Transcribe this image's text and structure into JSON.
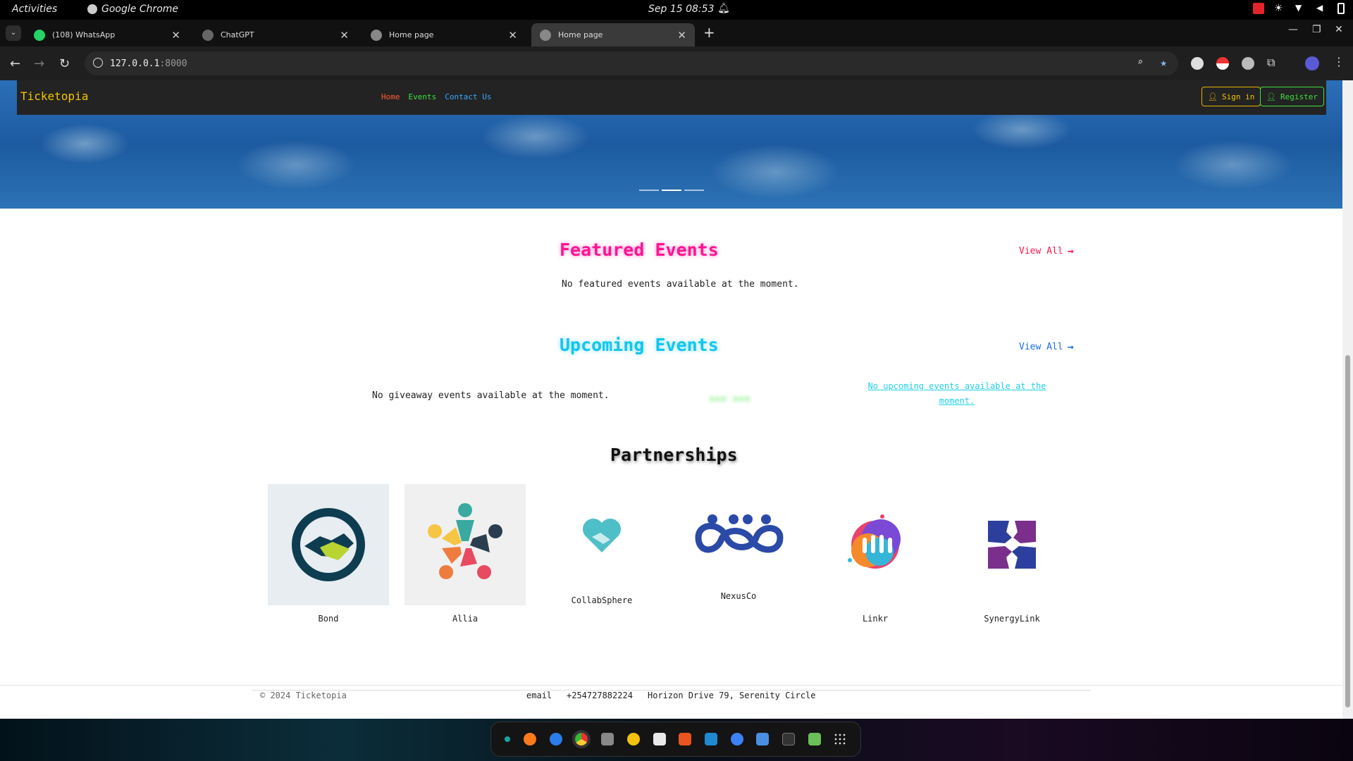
{
  "os": {
    "activities": "Activities",
    "app_name": "Google Chrome",
    "clock": "Sep 15 08:53"
  },
  "tabs": [
    {
      "label": "(108) WhatsApp",
      "active": false
    },
    {
      "label": "ChatGPT",
      "active": false
    },
    {
      "label": "Home page",
      "active": false
    },
    {
      "label": "Home page",
      "active": true
    }
  ],
  "address": {
    "host": "127.0.0.1",
    "port": ":8000"
  },
  "site": {
    "brand": "Ticketopia",
    "nav": {
      "home": "Home",
      "events": "Events",
      "contact": "Contact Us"
    },
    "signin": "Sign in",
    "register": "Register"
  },
  "featured": {
    "title": "Featured Events",
    "view_all": "View All",
    "empty": "No featured events available at the moment."
  },
  "upcoming": {
    "title": "Upcoming Events",
    "view_all": "View All",
    "giveaway_empty": "No giveaway events available at the moment.",
    "upcoming_empty": "No upcoming events available at the moment."
  },
  "partnerships": {
    "title": "Partnerships",
    "partners": [
      "Bond",
      "Allia",
      "CollabSphere",
      "NexusCo",
      "Linkr",
      "SynergyLink"
    ]
  },
  "footer": {
    "copyright": "© 2024 Ticketopia",
    "email": "email",
    "phone": "+254727882224",
    "address": "Horizon Drive 79, Serenity Circle"
  },
  "colors": {
    "brand": "#f3c600",
    "featured_title": "#ff1493",
    "featured_viewall": "#ff1a4f",
    "upcoming_title": "#12c6ef",
    "upcoming_viewall": "#1e6fe8",
    "nav_home": "#ff5a36",
    "nav_events": "#3fe03f",
    "nav_contact": "#3aa8ff"
  }
}
